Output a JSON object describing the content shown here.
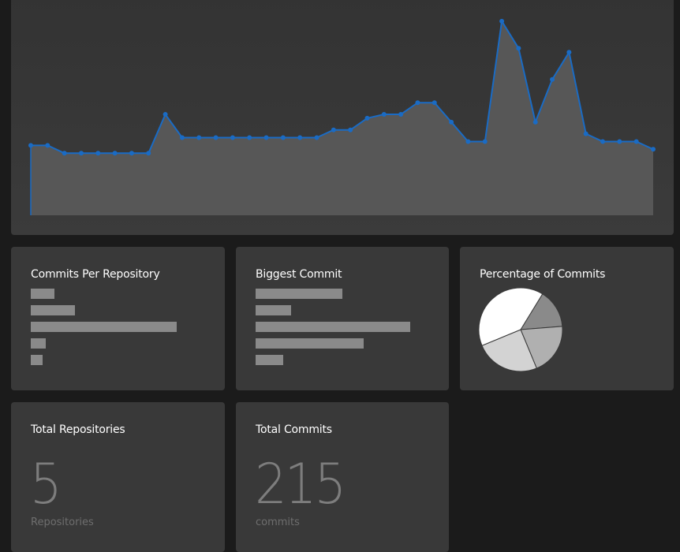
{
  "colors": {
    "page_bg": "#1b1b1b",
    "card_bg": "#393939",
    "area_fill": "#575757",
    "line": "#1a6bc4",
    "bar": "#8a8a8a",
    "pie": [
      "#ffffff",
      "#d3d3d3",
      "#b0b0b0",
      "#8a8a8a"
    ]
  },
  "chart_data": [
    {
      "type": "area",
      "title": "",
      "x": [
        1,
        2,
        3,
        4,
        5,
        6,
        7,
        8,
        9,
        10,
        11,
        12,
        13,
        14,
        15,
        16,
        17,
        18,
        19,
        20,
        21,
        22,
        23,
        24,
        25,
        26,
        27,
        28,
        29,
        30,
        31,
        32,
        33,
        34,
        35,
        36,
        37,
        38
      ],
      "values": [
        9,
        9,
        8,
        8,
        8,
        8,
        8,
        8,
        13,
        10,
        10,
        10,
        10,
        10,
        10,
        10,
        10,
        10,
        11,
        11,
        12.5,
        13,
        13,
        14.5,
        14.5,
        12,
        9.5,
        9.5,
        25,
        21.5,
        12,
        17.5,
        21,
        10.5,
        9.5,
        9.5,
        9.5,
        8.5
      ],
      "ylim": [
        0,
        26
      ],
      "markers": true
    },
    {
      "type": "bar",
      "orientation": "horizontal",
      "title": "Commits Per Repository",
      "values": [
        16,
        30,
        100,
        10,
        8
      ]
    },
    {
      "type": "bar",
      "orientation": "horizontal",
      "title": "Biggest Commit",
      "values": [
        56,
        23,
        100,
        70,
        18
      ]
    },
    {
      "type": "pie",
      "title": "Percentage of Commits",
      "values": [
        40,
        25,
        20,
        15
      ]
    }
  ],
  "cards": {
    "total_repositories": {
      "title": "Total Repositories",
      "value": "5",
      "unit": "Repositories"
    },
    "total_commits": {
      "title": "Total Commits",
      "value": "215",
      "unit": "commits"
    }
  }
}
